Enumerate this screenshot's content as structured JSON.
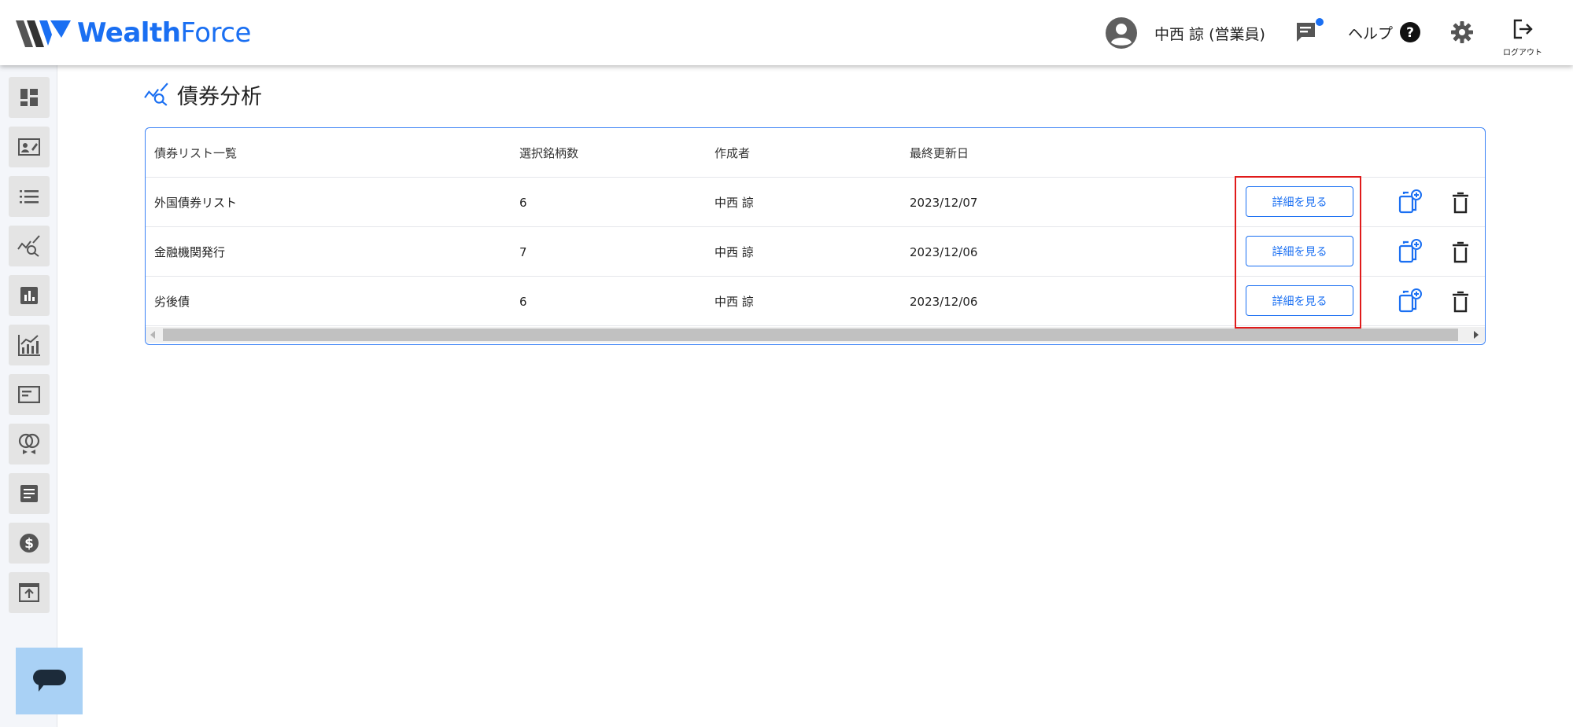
{
  "header": {
    "brand_part1": "Wealth",
    "brand_part2": "Force",
    "user_name": "中西 諒 (営業員)",
    "help_label": "ヘルプ",
    "logout_label": "ログアウト"
  },
  "sidebar": {
    "items": [
      {
        "icon": "dashboard-icon"
      },
      {
        "icon": "contact-card-icon"
      },
      {
        "icon": "list-icon"
      },
      {
        "icon": "bond-analysis-icon"
      },
      {
        "icon": "bar-chart-icon"
      },
      {
        "icon": "growth-chart-icon"
      },
      {
        "icon": "document-panel-icon"
      },
      {
        "icon": "rings-icon"
      },
      {
        "icon": "article-icon"
      },
      {
        "icon": "dollar-icon"
      },
      {
        "icon": "upload-icon"
      }
    ]
  },
  "page": {
    "title": "債券分析",
    "title_icon": "bond-analysis-icon"
  },
  "table": {
    "headers": [
      "債券リスト一覧",
      "選択銘柄数",
      "作成者",
      "最終更新日"
    ],
    "rows": [
      {
        "name": "外国債券リスト",
        "count": "6",
        "creator": "中西 諒",
        "updated": "2023/12/07",
        "action": "詳細を見る"
      },
      {
        "name": "金融機関発行",
        "count": "7",
        "creator": "中西 諒",
        "updated": "2023/12/06",
        "action": "詳細を見る"
      },
      {
        "name": "劣後債",
        "count": "6",
        "creator": "中西 諒",
        "updated": "2023/12/06",
        "action": "詳細を見る"
      }
    ]
  },
  "colors": {
    "accent": "#1a6ff2",
    "highlight": "#e01b1b",
    "sidebar_bg": "#f4f6fa",
    "chat_widget": "#a9d1f5"
  }
}
